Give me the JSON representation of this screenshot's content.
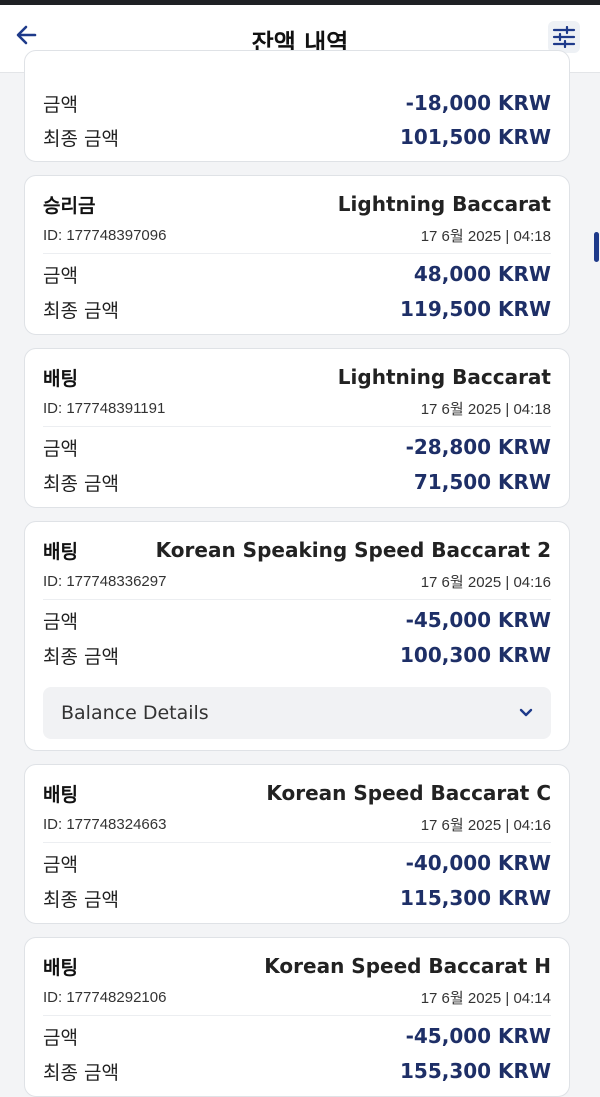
{
  "header": {
    "title": "잔액 내역"
  },
  "labels": {
    "amount": "금액",
    "final_amount": "최종 금액"
  },
  "card0": {
    "amount": "-18,000 KRW",
    "final": "101,500 KRW"
  },
  "card1": {
    "type": "승리금",
    "game": "Lightning Baccarat",
    "id": "ID: 177748397096",
    "date": "17 6월 2025 | 04:18",
    "amount": "48,000 KRW",
    "final": "119,500 KRW"
  },
  "card2": {
    "type": "배팅",
    "game": "Lightning Baccarat",
    "id": "ID: 177748391191",
    "date": "17 6월 2025 | 04:18",
    "amount": "-28,800 KRW",
    "final": "71,500 KRW"
  },
  "card3": {
    "type": "배팅",
    "game": "Korean Speaking Speed Baccarat 2",
    "id": "ID: 177748336297",
    "date": "17 6월 2025 | 04:16",
    "amount": "-45,000 KRW",
    "final": "100,300 KRW",
    "details_label": "Balance Details"
  },
  "card4": {
    "type": "배팅",
    "game": "Korean Speed Baccarat C",
    "id": "ID: 177748324663",
    "date": "17 6월 2025 | 04:16",
    "amount": "-40,000 KRW",
    "final": "115,300 KRW"
  },
  "card5": {
    "type": "배팅",
    "game": "Korean Speed Baccarat H",
    "id": "ID: 177748292106",
    "date": "17 6월 2025 | 04:14",
    "amount": "-45,000 KRW",
    "final": "155,300 KRW"
  },
  "colors": {
    "accent": "#1e2f67",
    "background": "#f3f4f6",
    "card": "#ffffff"
  },
  "icons": {
    "back": "arrow-left-icon",
    "filter": "sliders-icon",
    "expand": "chevron-down-icon"
  }
}
